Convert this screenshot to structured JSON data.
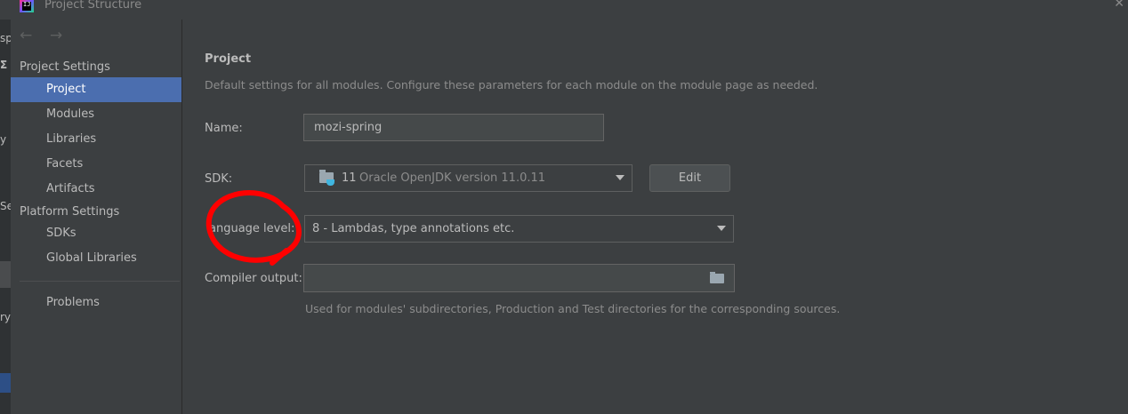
{
  "window": {
    "title": "Project Structure",
    "app_icon_text": "IJ",
    "close_glyph": "✕"
  },
  "background_fragments": [
    "sp",
    "Σ",
    "y",
    "Se",
    "ry"
  ],
  "nav": {
    "back_glyph": "←",
    "forward_glyph": "→"
  },
  "sidebar": {
    "groups": [
      {
        "label": "Project Settings",
        "items": [
          "Project",
          "Modules",
          "Libraries",
          "Facets",
          "Artifacts"
        ]
      },
      {
        "label": "Platform Settings",
        "items": [
          "SDKs",
          "Global Libraries"
        ]
      }
    ],
    "problems": "Problems",
    "selected": "Project"
  },
  "main": {
    "title": "Project",
    "description": "Default settings for all modules. Configure these parameters for each module on the module page as needed.",
    "name_label": "Name:",
    "name_value": "mozi-spring",
    "sdk_label": "SDK:",
    "sdk_version": "11",
    "sdk_text": "Oracle OpenJDK version 11.0.11",
    "edit_button": "Edit",
    "language_level_label": "anguage level:",
    "language_level_value": "8 - Lambdas, type annotations etc.",
    "compiler_output_label": "Compiler output:",
    "compiler_output_value": "",
    "compiler_output_hint": "Used for modules' subdirectories, Production and Test directories for the corresponding sources."
  },
  "colors": {
    "background": "#3c3f41",
    "selection": "#4b6eaf",
    "annotation": "#ff0000"
  },
  "icons": [
    "back-arrow-icon",
    "forward-arrow-icon",
    "folder-icon",
    "dropdown-arrow-icon",
    "browse-folder-icon",
    "jdk-icon"
  ]
}
